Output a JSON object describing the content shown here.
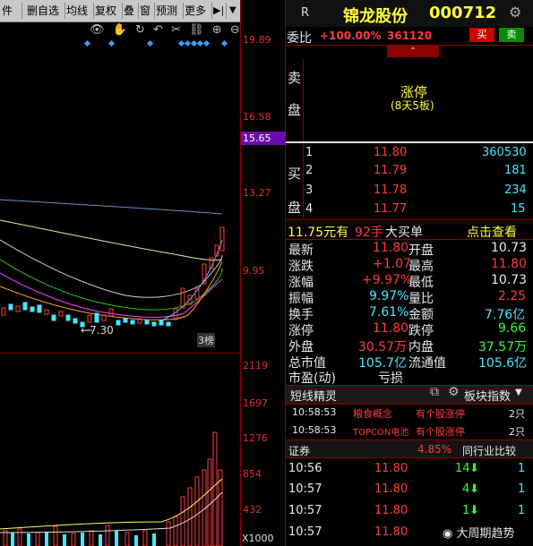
{
  "toolbar": {
    "items": [
      "件",
      "删自选",
      "均线",
      "复权",
      "叠",
      "窗",
      "预测",
      "更多"
    ],
    "nav_icon": "skip-icon",
    "dropdown_icon": "chevron-down-icon"
  },
  "chart_tools": [
    "👁",
    "✋",
    "↻",
    "↶",
    "✂",
    "⛓",
    "⊕",
    "⊖"
  ],
  "price_axis": [
    "19.89",
    "16.58",
    "15.65",
    "13.27",
    "9.95"
  ],
  "price_axis_current": "15.65",
  "low_price_label": "7.30",
  "event_tag": "3榜",
  "volume_axis": [
    "2119",
    "1697",
    "1276",
    "854",
    "432"
  ],
  "volume_unit": "X1000",
  "stock": {
    "marker": "R",
    "name": "锦龙股份",
    "code": "000712"
  },
  "committee": {
    "label": "委比",
    "ratio": "+100.00%",
    "diff": "361120",
    "buy_btn": "买",
    "sell_btn": "卖"
  },
  "sell_side": {
    "label_top": "卖",
    "label_bottom": "盘",
    "status": "涨停",
    "status_sub": "(8天5板)"
  },
  "buy_side": {
    "labels": [
      "买",
      "盘"
    ],
    "levels": [
      {
        "no": "1",
        "price": "11.80",
        "vol": "360530"
      },
      {
        "no": "2",
        "price": "11.79",
        "vol": "181"
      },
      {
        "no": "3",
        "price": "11.78",
        "vol": "234"
      },
      {
        "no": "4",
        "price": "11.77",
        "vol": "15"
      }
    ]
  },
  "big_order": {
    "price": "11.75元有",
    "qty": "92手",
    "type": "大买单",
    "link": "点击查看"
  },
  "quotes": [
    {
      "l1": "最新",
      "v1": "11.80",
      "l2": "开盘",
      "v2": "10.73"
    },
    {
      "l1": "涨跌",
      "v1": "+1.07",
      "l2": "最高",
      "v2": "11.80"
    },
    {
      "l1": "涨幅",
      "v1": "+9.97%",
      "l2": "最低",
      "v2": "10.73"
    },
    {
      "l1": "振幅",
      "v1": "9.97%",
      "l2": "量比",
      "v2": "2.25"
    },
    {
      "l1": "换手",
      "v1": "7.61%",
      "l2": "金额",
      "v2": "7.76亿"
    },
    {
      "l1": "涨停",
      "v1": "11.80",
      "l2": "跌停",
      "v2": "9.66"
    },
    {
      "l1": "外盘",
      "v1": "30.57万",
      "l2": "内盘",
      "v2": "37.57万"
    },
    {
      "l1": "总市值",
      "v1": "105.7亿",
      "l2": "流通值",
      "v2": "105.6亿"
    },
    {
      "l1": "市盈(动)",
      "v1": "亏损",
      "l2": "",
      "v2": ""
    }
  ],
  "short_line": {
    "title": "短线精灵",
    "block_index": "板块指数",
    "items": [
      {
        "time": "10:58:53",
        "concept": "粮食概念",
        "event": "有个股涨停",
        "count": "2只"
      },
      {
        "time": "10:58:53",
        "concept": "TOPCON电池",
        "event": "有个股涨停",
        "count": "2只"
      }
    ]
  },
  "industry": {
    "name": "证券",
    "pct": "4.85%",
    "compare": "同行业比较"
  },
  "ticks": [
    {
      "time": "10:56",
      "price": "11.80",
      "vol": "14",
      "arrow": "down"
    },
    {
      "time": "10:57",
      "price": "11.80",
      "vol": "4",
      "arrow": "down"
    },
    {
      "time": "10:57",
      "price": "11.80",
      "vol": "1",
      "arrow": "down"
    },
    {
      "time": "10:57",
      "price": "11.80",
      "vol": "",
      "arrow": ""
    }
  ],
  "watermark": "大周期趋势",
  "colors": {
    "up": "#ff3c3c",
    "down": "#2eff2e",
    "accent": "#44e8ff",
    "label_yellow": "#ffff33"
  }
}
